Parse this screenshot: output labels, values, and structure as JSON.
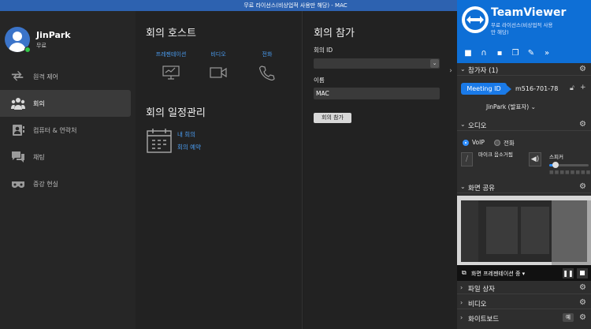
{
  "window": {
    "title": "무료 라이선스(비상업적 사용만 해당) - MAC"
  },
  "user": {
    "name": "JinPark",
    "status": "무료"
  },
  "nav": [
    {
      "label": "원격 제어",
      "icon": "arrows-icon"
    },
    {
      "label": "회의",
      "icon": "people-icon"
    },
    {
      "label": "컴퓨터 & 연락처",
      "icon": "contacts-icon"
    },
    {
      "label": "채팅",
      "icon": "chat-icon"
    },
    {
      "label": "증강 현실",
      "icon": "ar-glasses-icon"
    }
  ],
  "host": {
    "title": "회의 호스트",
    "options": [
      {
        "label": "프레젠테이션",
        "icon": "presentation-icon"
      },
      {
        "label": "비디오",
        "icon": "video-icon"
      },
      {
        "label": "전화",
        "icon": "phone-icon"
      }
    ],
    "schedule_title": "회의 일정관리",
    "schedule_links": [
      "내 회의",
      "회의 예약"
    ]
  },
  "join": {
    "title": "회의 참가",
    "id_label": "회의 ID",
    "id_value": "",
    "name_label": "이름",
    "name_value": "MAC",
    "button": "회의 참가"
  },
  "panel": {
    "brand": "TeamViewer",
    "subtitle": "무료 라이선스(비상업적 사용만 해당)",
    "sections": {
      "participants": "참가자 (1)",
      "audio": "오디오",
      "screen_share": "화면 공유",
      "file_box": "파일 상자",
      "video": "비디오",
      "whiteboard": "화이트보드"
    },
    "meeting_id_label": "Meeting ID",
    "meeting_id": "m516-701-78",
    "host_name": "JinPark (발표자)",
    "voip": "VoIP",
    "phone": "전화",
    "mic_label": "마이크 음소거됨",
    "speaker_label": "스피커",
    "speaker_level": 0.15,
    "share_label": "화면 프레젠테이션 중",
    "whiteboard_badge": "예"
  }
}
